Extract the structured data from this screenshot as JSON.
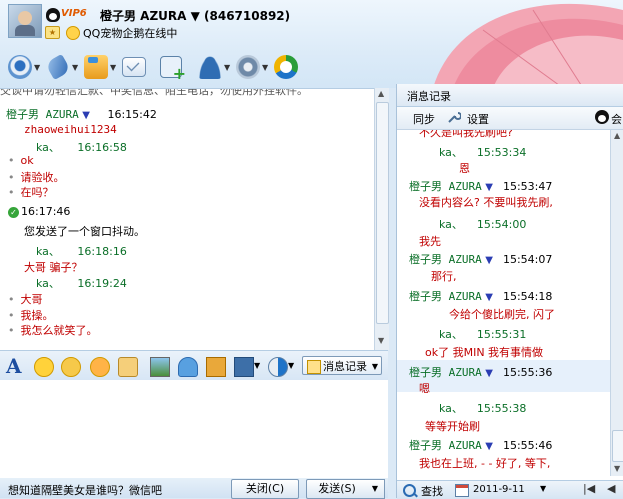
{
  "header": {
    "vip": "VIP6",
    "contact_name": "橙子男 AZURA ▼ (846710892)",
    "status": "QQ宠物企鹅在线中"
  },
  "chat": {
    "notice": "交谈中请勿轻信汇款、中奖信息、陌生电话，勿使用外挂软件。",
    "entries": [
      {
        "type": "hdr",
        "name": "橙子男 AZURA",
        "time": "16:15:42"
      },
      {
        "type": "mono",
        "text": "zhaoweihui1234"
      },
      {
        "type": "hdr2",
        "name": "ka、",
        "time": "16:16:58"
      },
      {
        "type": "bmsg",
        "text": "ok",
        "color": "#c00000"
      },
      {
        "type": "bmsg",
        "text": "请验收。",
        "color": "#c00000"
      },
      {
        "type": "bmsg",
        "text": "在吗？",
        "color": "#c00000"
      },
      {
        "type": "sys",
        "time": "16:17:46"
      },
      {
        "type": "plain",
        "text": "您发送了一个窗口抖动。"
      },
      {
        "type": "hdr2",
        "name": "ka、",
        "time": "16:18:16"
      },
      {
        "type": "plain_red",
        "text": "大哥 骗子？"
      },
      {
        "type": "hdr2",
        "name": "ka、",
        "time": "16:19:24"
      },
      {
        "type": "bmsg",
        "text": "大哥",
        "color": "#c00000"
      },
      {
        "type": "bmsg",
        "text": "我操。",
        "color": "#c00000"
      },
      {
        "type": "bmsg",
        "text": "我怎么就笑了。",
        "color": "#c00000"
      }
    ]
  },
  "toolbar_labels": {
    "msg_record": "消息记录"
  },
  "bottom": {
    "ad": "想知道隔壁美女是谁吗？微信吧",
    "close": "关闭(C)",
    "send": "发送(S)"
  },
  "history": {
    "title": "消息记录",
    "sync": "同步",
    "settings": "设置",
    "member": "会",
    "cut_top": "不久是叫我先刷吧?",
    "entries": [
      {
        "who": "ka、",
        "time": "15:53:34",
        "text": "恩"
      },
      {
        "who": "橙子男 AZURA",
        "time": "15:53:47",
        "text": "没看内容么?  不要叫我先刷,"
      },
      {
        "who": "ka、",
        "time": "15:54:00",
        "text": "我先"
      },
      {
        "who": "橙子男 AZURA",
        "time": "15:54:07",
        "text": "那行,"
      },
      {
        "who": "橙子男 AZURA",
        "time": "15:54:18",
        "text": "今给个傻比刷完, 闪了"
      },
      {
        "who": "ka、",
        "time": "15:55:31",
        "text": "ok了 我MIN 我有事情做"
      },
      {
        "who": "橙子男 AZURA",
        "time": "15:55:36",
        "text": "嗯"
      },
      {
        "who": "ka、",
        "time": "15:55:38",
        "text": "等等开始刷"
      },
      {
        "who": "橙子男 AZURA",
        "time": "15:55:46",
        "text": "我也在上班, - - 好了, 等下,"
      }
    ],
    "search": "查找",
    "date": "2011-9-11"
  },
  "colors": {
    "name_green": "#0b6f28",
    "msg_red": "#c00000",
    "other_name": "#0b6f28"
  }
}
